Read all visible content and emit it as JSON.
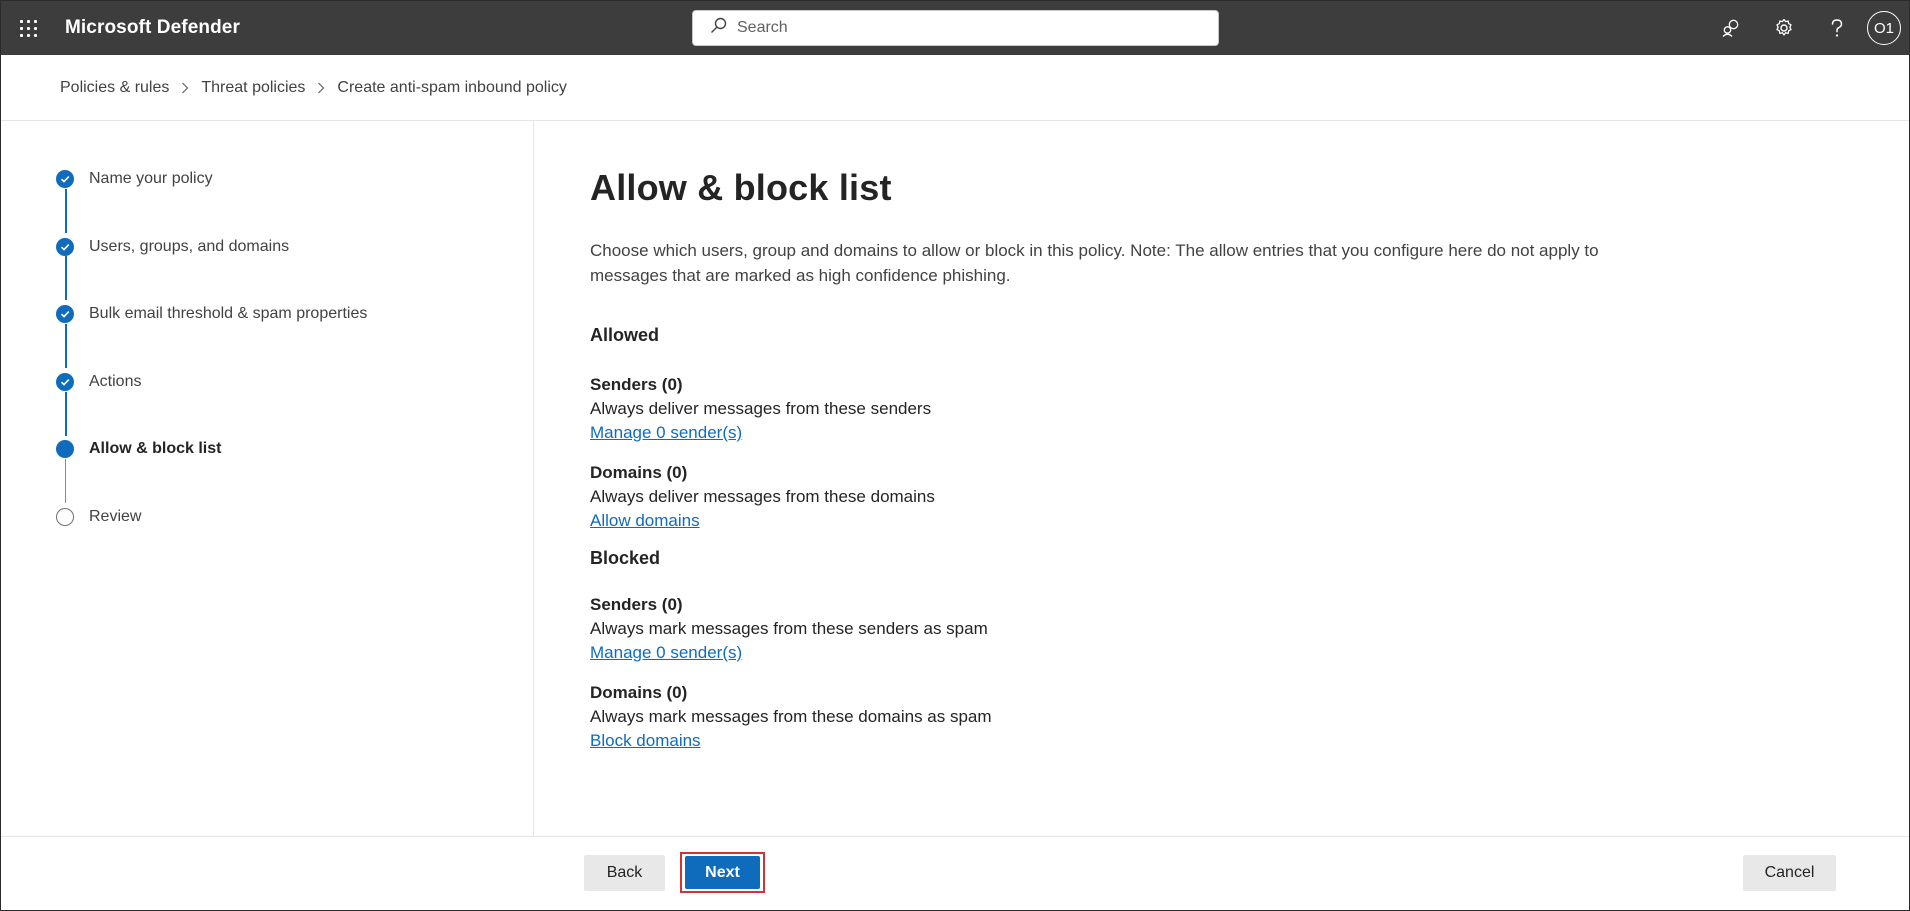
{
  "app": {
    "title": "Microsoft Defender",
    "search_placeholder": "Search",
    "avatar_initials": "O1",
    "icons": [
      "waffle-icon",
      "search-icon",
      "community-icon",
      "gear-icon",
      "help-icon"
    ]
  },
  "breadcrumb": {
    "items": [
      "Policies & rules",
      "Threat policies",
      "Create anti-spam inbound policy"
    ]
  },
  "steps": [
    {
      "label": "Name your policy",
      "state": "done"
    },
    {
      "label": "Users, groups, and domains",
      "state": "done"
    },
    {
      "label": "Bulk email threshold & spam properties",
      "state": "done"
    },
    {
      "label": "Actions",
      "state": "done"
    },
    {
      "label": "Allow & block list",
      "state": "current"
    },
    {
      "label": "Review",
      "state": "todo"
    }
  ],
  "content": {
    "title": "Allow & block list",
    "description": "Choose which users, group and domains to allow or block in this policy. Note: The allow entries that you configure here do not apply to messages that are marked as high confidence phishing.",
    "allowed": {
      "heading": "Allowed",
      "senders": {
        "title": "Senders (0)",
        "desc": "Always deliver messages from these senders",
        "link": "Manage 0 sender(s)"
      },
      "domains": {
        "title": "Domains (0)",
        "desc": "Always deliver messages from these domains",
        "link": "Allow domains"
      }
    },
    "blocked": {
      "heading": "Blocked",
      "senders": {
        "title": "Senders (0)",
        "desc": "Always mark messages from these senders as spam",
        "link": "Manage 0 sender(s)"
      },
      "domains": {
        "title": "Domains (0)",
        "desc": "Always mark messages from these domains as spam",
        "link": "Block domains"
      }
    }
  },
  "footer": {
    "back_label": "Back",
    "next_label": "Next",
    "cancel_label": "Cancel"
  },
  "colors": {
    "accent": "#0f6cbd",
    "topbar": "#3d3d3d",
    "highlight": "#d13438"
  }
}
